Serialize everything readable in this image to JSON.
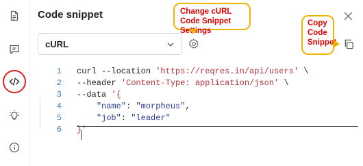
{
  "panel": {
    "title": "Code snippet",
    "language_value": "cURL"
  },
  "annotations": {
    "settings_callout": "Change cURL Code Snippet Settings",
    "copy_callout": "Copy Code Snippet",
    "accent_color": "#e00000",
    "border_color": "#f0b400"
  },
  "sidebar": {
    "items": [
      {
        "icon": "document-icon"
      },
      {
        "icon": "comment-icon"
      },
      {
        "icon": "code-icon",
        "active": true
      },
      {
        "icon": "lightbulb-icon"
      },
      {
        "icon": "info-icon"
      }
    ]
  },
  "code": {
    "lines": [
      {
        "n": "1",
        "parts": [
          {
            "t": "curl --location ",
            "c": ""
          },
          {
            "t": "'https://reqres.in/api/users'",
            "c": "str"
          },
          {
            "t": " \\",
            "c": ""
          }
        ]
      },
      {
        "n": "2",
        "parts": [
          {
            "t": "--header ",
            "c": ""
          },
          {
            "t": "'Content-Type: application/json'",
            "c": "str"
          },
          {
            "t": " \\",
            "c": ""
          }
        ]
      },
      {
        "n": "3",
        "parts": [
          {
            "t": "--data ",
            "c": ""
          },
          {
            "t": "'{",
            "c": "str"
          }
        ]
      },
      {
        "n": "4",
        "parts": [
          {
            "t": "    ",
            "c": ""
          },
          {
            "t": "\"name\"",
            "c": "key"
          },
          {
            "t": ": ",
            "c": ""
          },
          {
            "t": "\"morpheus\"",
            "c": "key"
          },
          {
            "t": ",",
            "c": ""
          }
        ]
      },
      {
        "n": "5",
        "parts": [
          {
            "t": "    ",
            "c": ""
          },
          {
            "t": "\"job\"",
            "c": "key"
          },
          {
            "t": ": ",
            "c": ""
          },
          {
            "t": "\"leader\"",
            "c": "key"
          }
        ]
      },
      {
        "n": "6",
        "parts": [
          {
            "t": "}'",
            "c": "str"
          }
        ]
      }
    ]
  }
}
